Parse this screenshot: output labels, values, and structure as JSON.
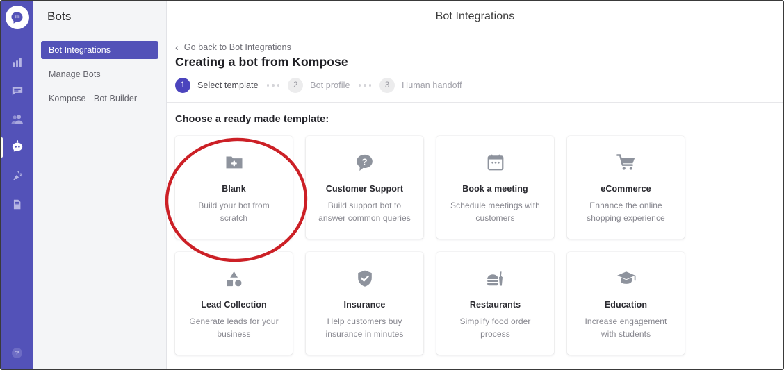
{
  "rail": {
    "logo_icon": "kommunicate-logo-icon",
    "items": [
      {
        "icon": "analytics-bar-chart-icon",
        "name": "analytics",
        "active": false
      },
      {
        "icon": "conversations-chat-icon",
        "name": "conversations",
        "active": false
      },
      {
        "icon": "users-icon",
        "name": "users",
        "active": false
      },
      {
        "icon": "bot-robot-icon",
        "name": "bots",
        "active": true
      },
      {
        "icon": "integrations-plug-icon",
        "name": "integrations",
        "active": false
      },
      {
        "icon": "docs-file-icon",
        "name": "docs",
        "active": false
      }
    ],
    "help_icon": "help-question-icon"
  },
  "sidebar": {
    "title": "Bots",
    "items": [
      {
        "label": "Bot Integrations",
        "active": true
      },
      {
        "label": "Manage Bots",
        "active": false
      },
      {
        "label": "Kompose - Bot Builder",
        "active": false
      }
    ]
  },
  "header": {
    "title": "Bot Integrations"
  },
  "breadcrumb": {
    "back_icon": "chevron-left-icon",
    "label": "Go back to Bot Integrations"
  },
  "page": {
    "title": "Creating a bot from Kompose"
  },
  "stepper": {
    "steps": [
      {
        "number": "1",
        "label": "Select template",
        "active": true
      },
      {
        "number": "2",
        "label": "Bot profile",
        "active": false
      },
      {
        "number": "3",
        "label": "Human handoff",
        "active": false
      }
    ]
  },
  "templates": {
    "heading": "Choose a ready made template:",
    "cards": [
      {
        "icon": "folder-plus-icon",
        "title": "Blank",
        "desc": "Build your bot from scratch"
      },
      {
        "icon": "question-chat-icon",
        "title": "Customer Support",
        "desc": "Build support bot to answer common queries"
      },
      {
        "icon": "calendar-icon",
        "title": "Book a meeting",
        "desc": "Schedule meetings with customers"
      },
      {
        "icon": "shopping-cart-icon",
        "title": "eCommerce",
        "desc": "Enhance the online shopping experience"
      },
      {
        "icon": "shapes-icon",
        "title": "Lead Collection",
        "desc": "Generate leads for your business"
      },
      {
        "icon": "shield-check-icon",
        "title": "Insurance",
        "desc": "Help customers buy insurance in minutes"
      },
      {
        "icon": "food-burger-icon",
        "title": "Restaurants",
        "desc": "Simplify food order process"
      },
      {
        "icon": "graduation-cap-icon",
        "title": "Education",
        "desc": "Increase engagement with students"
      }
    ]
  },
  "annotation": {
    "shape": "ellipse-highlight",
    "color": "#cc2026",
    "target": "Blank"
  },
  "colors": {
    "brand_purple": "#5352b8",
    "active_step": "#4b44bd",
    "sidebar_bg": "#f4f5f7",
    "icon_gray": "#8e939d",
    "annotation_red": "#cc2026"
  }
}
